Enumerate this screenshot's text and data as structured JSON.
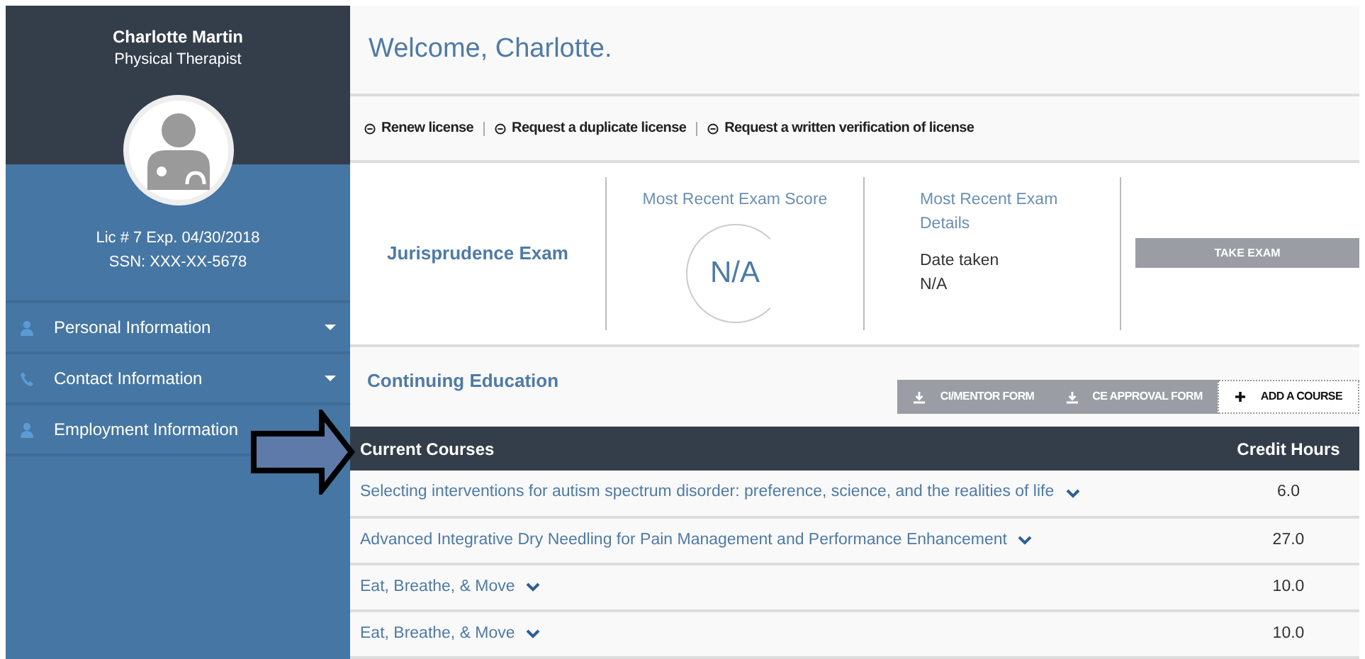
{
  "profile": {
    "name": "Charlotte Martin",
    "title": "Physical Therapist",
    "license": "Lic # 7 Exp. 04/30/2018",
    "ssn": "SSN: XXX-XX-5678"
  },
  "menu": [
    {
      "label": "Personal Information",
      "kind": "person"
    },
    {
      "label": "Contact Information",
      "kind": "phone"
    },
    {
      "label": "Employment Information",
      "kind": "person"
    }
  ],
  "welcome": "Welcome, Charlotte.",
  "license_links": [
    "Renew license",
    "Request a duplicate license",
    "Request a written verification of license"
  ],
  "exam": {
    "title": "Jurisprudence Exam",
    "score_label": "Most Recent Exam Score",
    "score": "N/A",
    "details_label": "Most Recent Exam Details",
    "date_label": "Date taken",
    "date": "N/A",
    "button": "TAKE EXAM"
  },
  "continuing_education": {
    "title": "Continuing Education",
    "buttons": [
      {
        "label": "CI/MENTOR FORM",
        "kind": "download"
      },
      {
        "label": "CE APPROVAL FORM",
        "kind": "download"
      },
      {
        "label": "ADD A COURSE",
        "kind": "add"
      }
    ]
  },
  "table": {
    "columns": [
      "Current Courses",
      "Credit Hours"
    ],
    "rows": [
      {
        "course": "Selecting interventions for autism spectrum disorder: preference, science, and the realities of life",
        "hours": "6.0"
      },
      {
        "course": "Advanced Integrative Dry Needling for Pain Management and Performance Enhancement",
        "hours": "27.0"
      },
      {
        "course": "Eat, Breathe, & Move",
        "hours": "10.0"
      },
      {
        "course": "Eat, Breathe, & Move",
        "hours": "10.0"
      }
    ]
  }
}
